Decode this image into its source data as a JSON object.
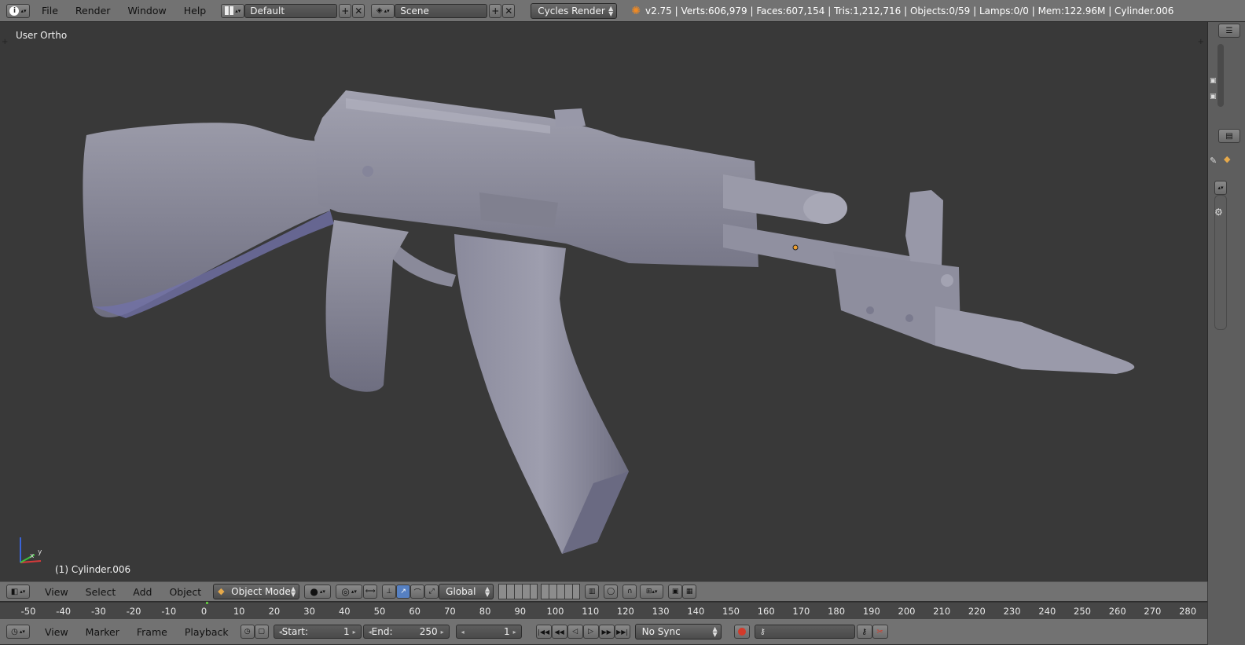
{
  "topbar": {
    "menus": [
      "File",
      "Render",
      "Window",
      "Help"
    ],
    "screen_layout": "Default",
    "scene": "Scene",
    "render_engine": "Cycles Render",
    "status": "v2.75 | Verts:606,979 | Faces:607,154 | Tris:1,212,716 | Objects:0/59 | Lamps:0/0 | Mem:122.96M | Cylinder.006"
  },
  "viewport": {
    "view_label": "User Ortho",
    "object_label": "(1) Cylinder.006",
    "axis_x": "x",
    "axis_y": "y"
  },
  "view3d_header": {
    "menus": [
      "View",
      "Select",
      "Add",
      "Object"
    ],
    "mode": "Object Mode",
    "orientation": "Global"
  },
  "timeline": {
    "ticks": [
      "-50",
      "-40",
      "-30",
      "-20",
      "-10",
      "0",
      "10",
      "20",
      "30",
      "40",
      "50",
      "60",
      "70",
      "80",
      "90",
      "100",
      "110",
      "120",
      "130",
      "140",
      "150",
      "160",
      "170",
      "180",
      "190",
      "200",
      "210",
      "220",
      "230",
      "240",
      "250",
      "260",
      "270",
      "280"
    ],
    "menus": [
      "View",
      "Marker",
      "Frame",
      "Playback"
    ],
    "start_label": "Start:",
    "start_value": "1",
    "end_label": "End:",
    "end_value": "250",
    "current_frame": "1",
    "sync": "No Sync"
  },
  "colors": {
    "viewport_bg": "#393939",
    "header_bg": "#727272",
    "model": "#8f8fa0",
    "keyframe_red": "#d33a2a"
  }
}
